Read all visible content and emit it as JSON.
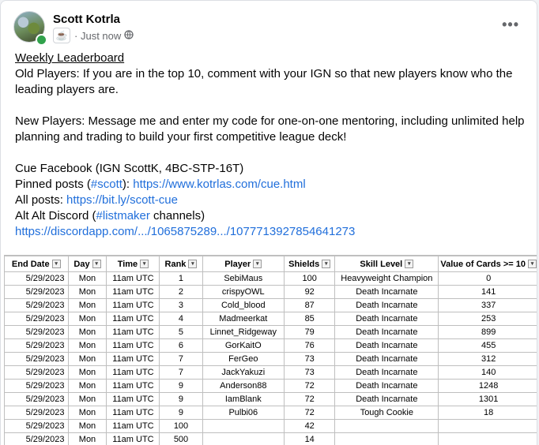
{
  "post": {
    "author": "Scott Kotrla",
    "status_emoji": "☕",
    "timestamp": "Just now",
    "separator": "·",
    "audience_icon": "globe-icon",
    "title": "Weekly Leaderboard",
    "line1": "Old Players: If you are in the top 10, comment with your IGN so that new players know who the leading players are.",
    "line2": "New Players: Message me and enter my code for one-on-one mentoring, including unlimited help planning and trading to build your first competitive league deck!",
    "line3": "Cue Facebook (IGN ScottK, 4BC-STP-16T)",
    "pinned_prefix": "Pinned posts (",
    "pinned_tag": "#scott",
    "pinned_mid": "): ",
    "pinned_link": "https://www.kotrlas.com/cue.html",
    "allposts_prefix": "All posts: ",
    "allposts_link": "https://bit.ly/scott-cue",
    "alt_prefix": "Alt Alt Discord (",
    "alt_tag": "#listmaker",
    "alt_suffix": " channels)",
    "discord_link": "https://discordapp.com/.../1065875289.../1077713927854641273"
  },
  "table": {
    "headers": [
      "End Date",
      "Day",
      "Time",
      "Rank",
      "Player",
      "Shields",
      "Skill Level",
      "Value of Cards >= 10"
    ],
    "rows": [
      [
        "5/29/2023",
        "Mon",
        "11am UTC",
        "1",
        "SebiMaus",
        "100",
        "Heavyweight Champion",
        "0"
      ],
      [
        "5/29/2023",
        "Mon",
        "11am UTC",
        "2",
        "crispyOWL",
        "92",
        "Death Incarnate",
        "141"
      ],
      [
        "5/29/2023",
        "Mon",
        "11am UTC",
        "3",
        "Cold_blood",
        "87",
        "Death Incarnate",
        "337"
      ],
      [
        "5/29/2023",
        "Mon",
        "11am UTC",
        "4",
        "Madmeerkat",
        "85",
        "Death Incarnate",
        "253"
      ],
      [
        "5/29/2023",
        "Mon",
        "11am UTC",
        "5",
        "Linnet_Ridgeway",
        "79",
        "Death Incarnate",
        "899"
      ],
      [
        "5/29/2023",
        "Mon",
        "11am UTC",
        "6",
        "GorKaitO",
        "76",
        "Death Incarnate",
        "455"
      ],
      [
        "5/29/2023",
        "Mon",
        "11am UTC",
        "7",
        "FerGeo",
        "73",
        "Death Incarnate",
        "312"
      ],
      [
        "5/29/2023",
        "Mon",
        "11am UTC",
        "7",
        "JackYakuzi",
        "73",
        "Death Incarnate",
        "140"
      ],
      [
        "5/29/2023",
        "Mon",
        "11am UTC",
        "9",
        "Anderson88",
        "72",
        "Death Incarnate",
        "1248"
      ],
      [
        "5/29/2023",
        "Mon",
        "11am UTC",
        "9",
        "IamBlank",
        "72",
        "Death Incarnate",
        "1301"
      ],
      [
        "5/29/2023",
        "Mon",
        "11am UTC",
        "9",
        "Pulbi06",
        "72",
        "Tough Cookie",
        "18"
      ],
      [
        "5/29/2023",
        "Mon",
        "11am UTC",
        "100",
        "",
        "42",
        "",
        ""
      ],
      [
        "5/29/2023",
        "Mon",
        "11am UTC",
        "500",
        "",
        "14",
        "",
        ""
      ]
    ]
  }
}
